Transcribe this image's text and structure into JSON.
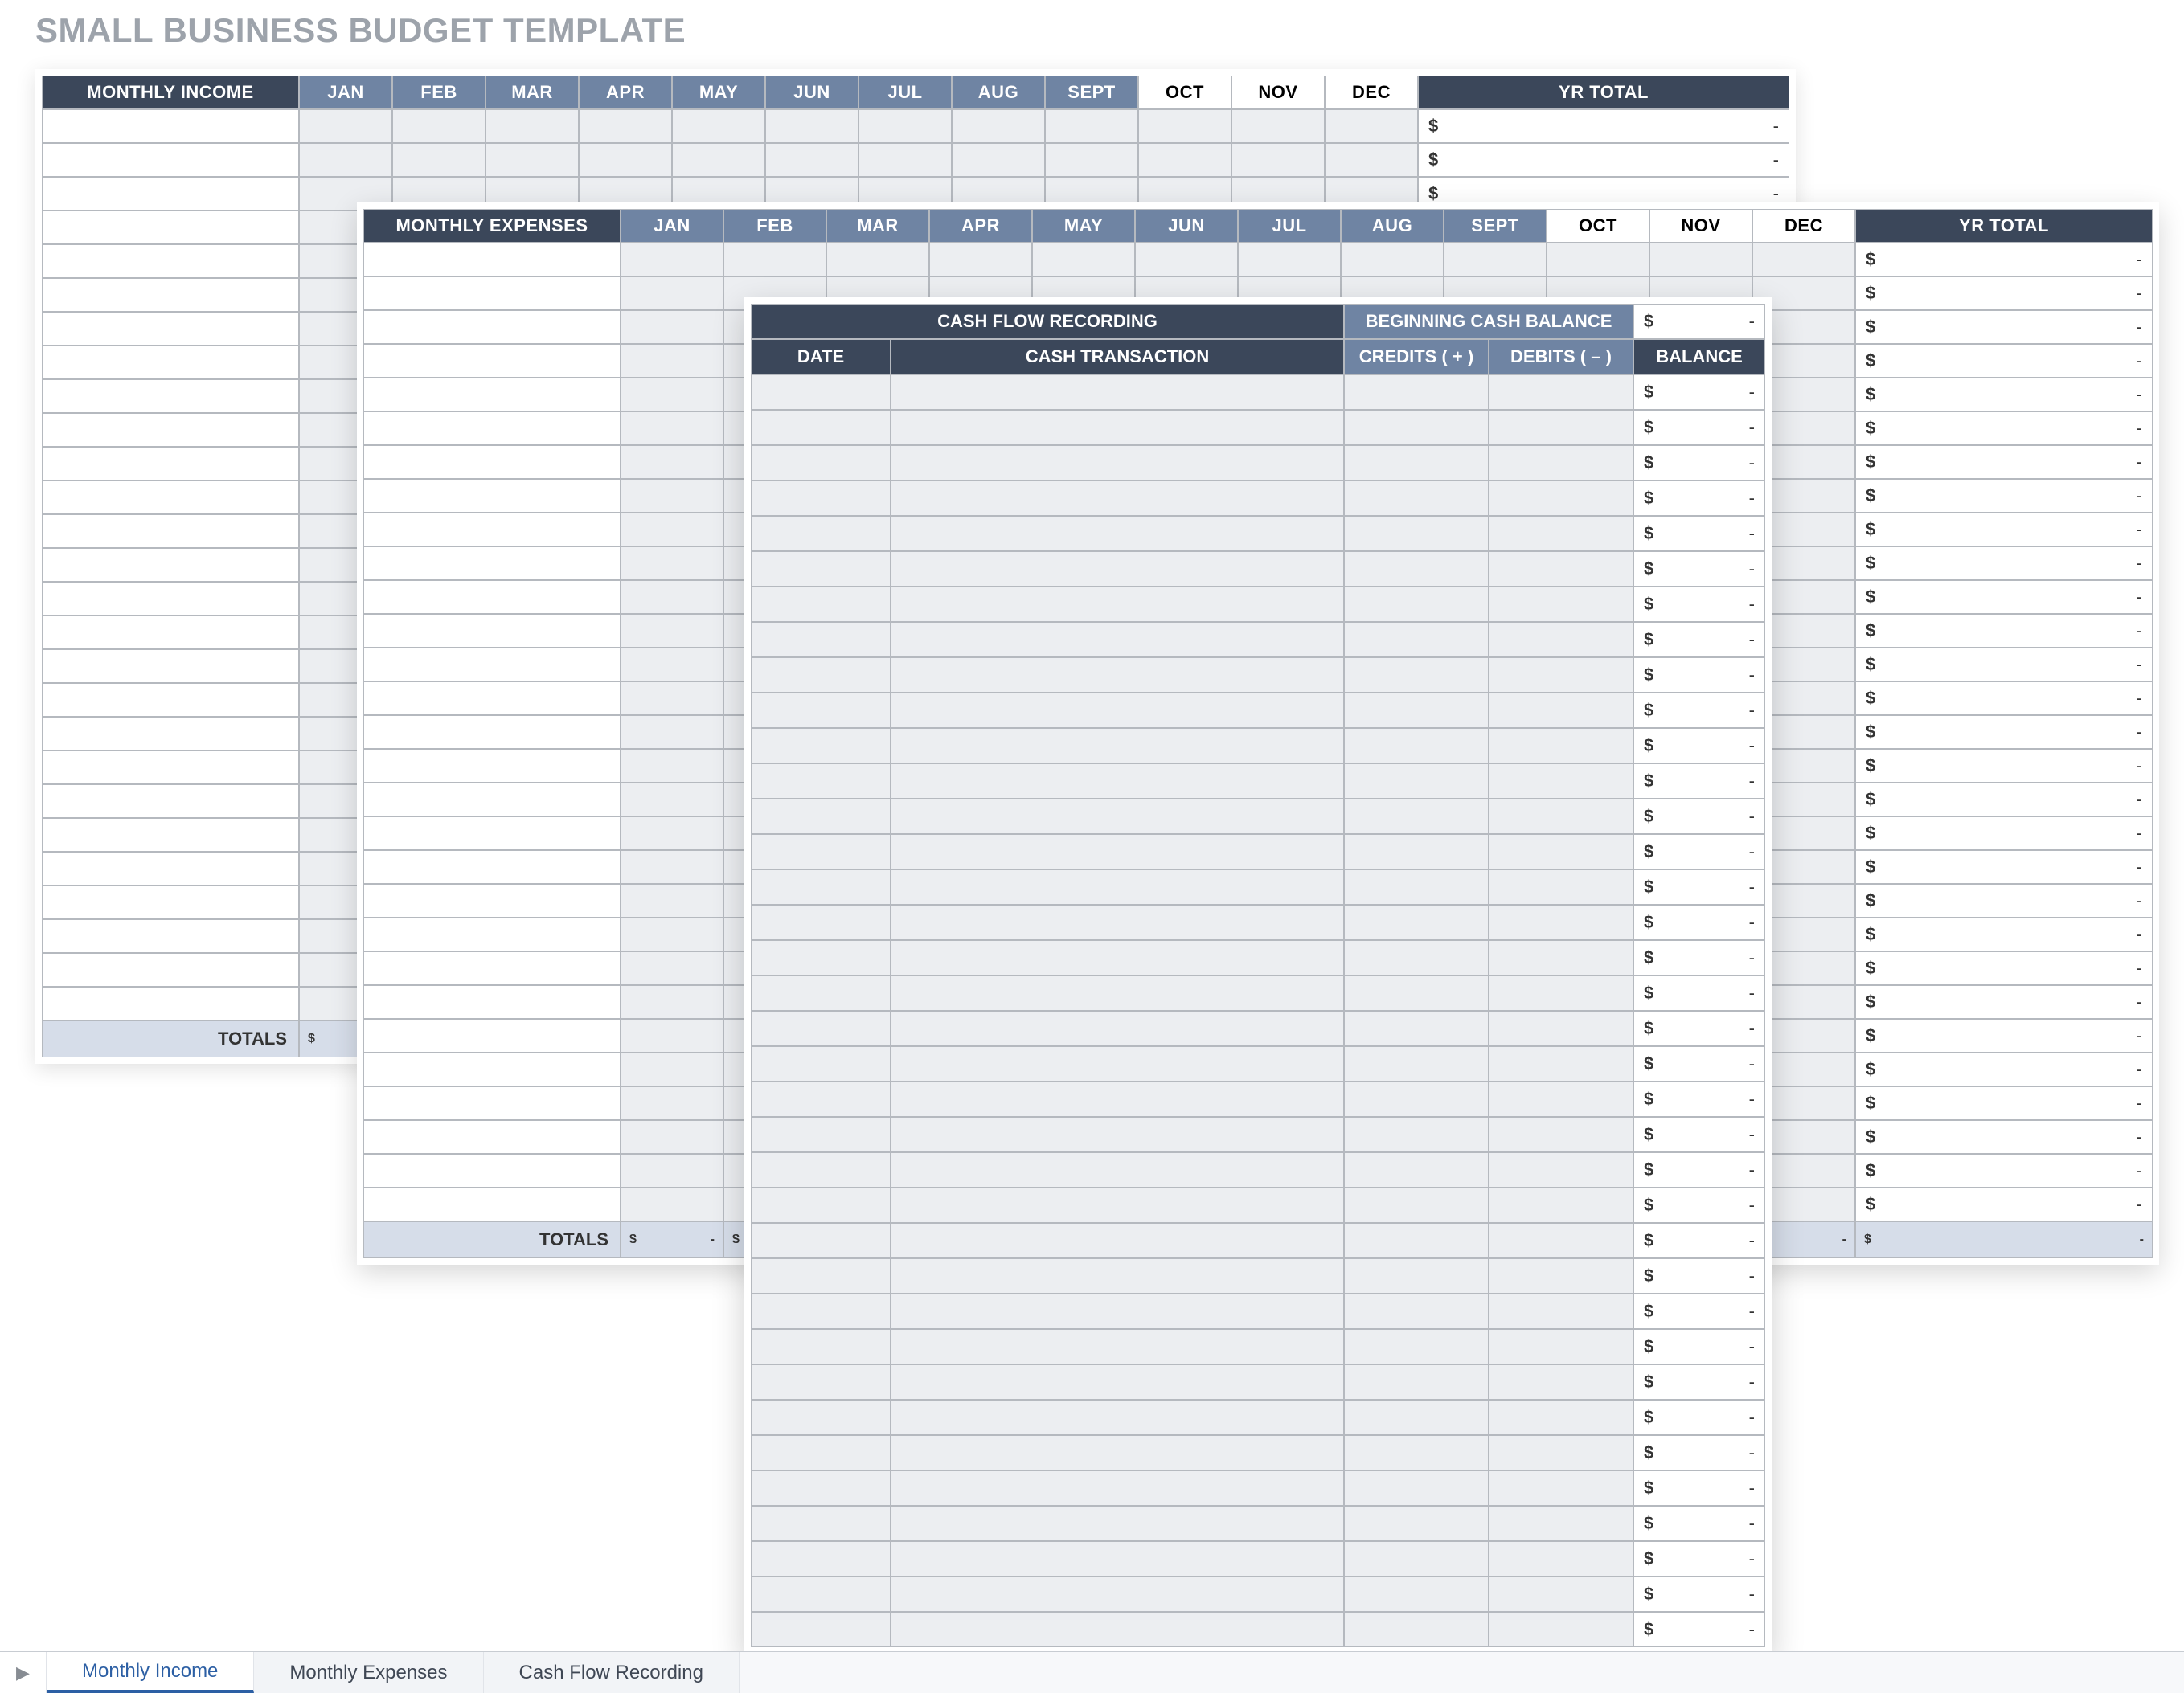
{
  "title": "SMALL BUSINESS BUDGET TEMPLATE",
  "months": [
    "JAN",
    "FEB",
    "MAR",
    "APR",
    "MAY",
    "JUN",
    "JUL",
    "AUG",
    "SEPT",
    "OCT",
    "NOV",
    "DEC"
  ],
  "yrTotalLabel": "YR TOTAL",
  "totalsLabel": "TOTALS",
  "currencySymbol": "$",
  "dashValue": "-",
  "income": {
    "header": "MONTHLY INCOME",
    "rowCount": 27
  },
  "expenses": {
    "header": "MONTHLY EXPENSES",
    "rowCount": 29
  },
  "cashflow": {
    "title": "CASH FLOW RECORDING",
    "beginningLabel": "BEGINNING CASH BALANCE",
    "columns": {
      "date": "DATE",
      "transaction": "CASH TRANSACTION",
      "credits": "CREDITS ( + )",
      "debits": "DEBITS ( – )",
      "balance": "BALANCE"
    },
    "rowCount": 36
  },
  "tabs": {
    "items": [
      "Monthly Income",
      "Monthly Expenses",
      "Cash Flow Recording"
    ],
    "active": 0,
    "arrow": "▶"
  }
}
